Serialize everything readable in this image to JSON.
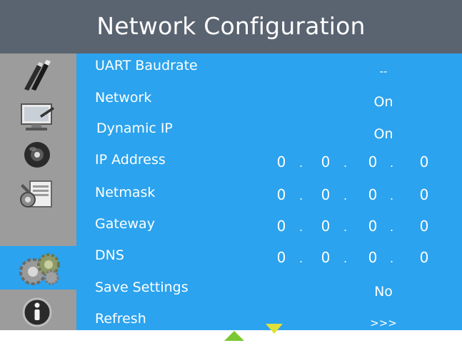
{
  "title": "Network Configuration",
  "sidebar": {
    "items": [
      {
        "icon": "tools-icon",
        "selected": false
      },
      {
        "icon": "monitor-icon",
        "selected": false
      },
      {
        "icon": "audio-icon",
        "selected": false
      },
      {
        "icon": "settings-icon",
        "selected": false
      },
      {
        "icon": "gears-icon",
        "selected": true
      },
      {
        "icon": "info-icon",
        "selected": false
      }
    ]
  },
  "settings": {
    "uart_baudrate": {
      "label": "UART Baudrate",
      "value": "--"
    },
    "network": {
      "label": "Network",
      "value": "On"
    },
    "dynamic_ip": {
      "label": "Dynamic IP",
      "value": "On"
    },
    "ip_address": {
      "label": "IP Address",
      "octets": [
        "0",
        "0",
        "0",
        "0"
      ]
    },
    "netmask": {
      "label": "Netmask",
      "octets": [
        "0",
        "0",
        "0",
        "0"
      ]
    },
    "gateway": {
      "label": "Gateway",
      "octets": [
        "0",
        "0",
        "0",
        "0"
      ]
    },
    "dns": {
      "label": "DNS",
      "octets": [
        "0",
        "0",
        "0",
        "0"
      ]
    },
    "save_settings": {
      "label": "Save Settings",
      "value": "No"
    },
    "refresh": {
      "label": "Refresh",
      "value": ">>>"
    }
  },
  "ip_separator": ".",
  "colors": {
    "title_bar": "#5a6370",
    "sidebar": "#9c9c9c",
    "content": "#2ba3ee",
    "selected": "#2ba3ee",
    "arrow_up": "#7cc832",
    "arrow_down": "#e0e03a"
  }
}
